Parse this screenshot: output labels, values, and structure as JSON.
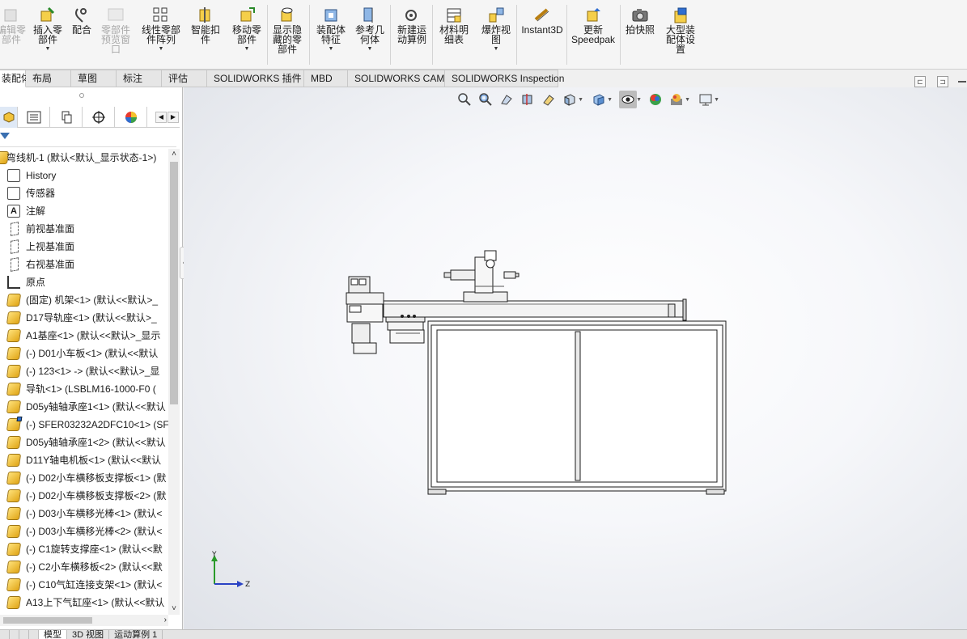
{
  "ribbon": {
    "buttons": [
      {
        "id": "edit-component",
        "label": "编辑零\n部件",
        "disabled": true
      },
      {
        "id": "insert-component",
        "label": "插入零\n部件",
        "dropdown": true
      },
      {
        "id": "mate",
        "label": "配合"
      },
      {
        "id": "component-preview",
        "label": "零部件\n预览窗\n口",
        "disabled": true
      },
      {
        "id": "linear-pattern",
        "label": "线性零部\n件阵列",
        "dropdown": true
      },
      {
        "id": "smart-fasteners",
        "label": "智能扣\n件"
      },
      {
        "id": "move-component",
        "label": "移动零\n部件",
        "dropdown": true
      },
      {
        "id": "show-hidden",
        "label": "显示隐\n藏的零\n部件"
      },
      {
        "id": "assembly-features",
        "label": "装配体\n特征",
        "dropdown": true
      },
      {
        "id": "reference-geometry",
        "label": "参考几\n何体",
        "dropdown": true
      },
      {
        "id": "new-motion-study",
        "label": "新建运\n动算例"
      },
      {
        "id": "bom",
        "label": "材料明\n细表"
      },
      {
        "id": "exploded-view",
        "label": "爆炸视\n图",
        "dropdown": true
      },
      {
        "id": "instant3d",
        "label": "Instant3D"
      },
      {
        "id": "update-speedpak",
        "label": "更新\nSpeedpak"
      },
      {
        "id": "take-snapshot",
        "label": "拍快照"
      },
      {
        "id": "large-assembly",
        "label": "大型装\n配体设\n置"
      }
    ]
  },
  "command_tabs": [
    "装配体",
    "布局",
    "草图",
    "标注",
    "评估",
    "SOLIDWORKS 插件",
    "MBD",
    "SOLIDWORKS CAM",
    "SOLIDWORKS Inspection"
  ],
  "tree": {
    "root": "弯线机-1  (默认<默认_显示状态-1>)",
    "items": [
      {
        "type": "history",
        "label": "History"
      },
      {
        "type": "sensor",
        "label": "传感器"
      },
      {
        "type": "annotation",
        "label": "注解"
      },
      {
        "type": "plane",
        "label": "前视基准面"
      },
      {
        "type": "plane",
        "label": "上视基准面"
      },
      {
        "type": "plane",
        "label": "右视基准面"
      },
      {
        "type": "origin",
        "label": "原点"
      },
      {
        "type": "part",
        "label": "(固定) 机架<1> (默认<<默认>_"
      },
      {
        "type": "part",
        "label": "D17导轨座<1> (默认<<默认>_"
      },
      {
        "type": "part",
        "label": "A1基座<1> (默认<<默认>_显示"
      },
      {
        "type": "part",
        "label": "(-) D01小车板<1> (默认<<默认"
      },
      {
        "type": "part",
        "label": "(-) 123<1> -> (默认<<默认>_显"
      },
      {
        "type": "part",
        "label": "导轨<1> (LSBLM16-1000-F0 ("
      },
      {
        "type": "part",
        "label": "D05y轴轴承座1<1> (默认<<默认"
      },
      {
        "type": "part-special",
        "label": "(-) SFER03232A2DFC10<1> (SF"
      },
      {
        "type": "part",
        "label": "D05y轴轴承座1<2> (默认<<默认"
      },
      {
        "type": "part",
        "label": "D11Y轴电机板<1> (默认<<默认"
      },
      {
        "type": "part",
        "label": "(-) D02小车横移板支撑板<1> (默"
      },
      {
        "type": "part",
        "label": "(-) D02小车横移板支撑板<2> (默"
      },
      {
        "type": "part",
        "label": "(-) D03小车横移光棒<1> (默认<"
      },
      {
        "type": "part",
        "label": "(-) D03小车横移光棒<2> (默认<"
      },
      {
        "type": "part",
        "label": "(-) C1旋转支撑座<1> (默认<<默"
      },
      {
        "type": "part",
        "label": "(-) C2小车横移板<2> (默认<<默"
      },
      {
        "type": "part",
        "label": "(-) C10气缸连接支架<1> (默认<"
      },
      {
        "type": "part",
        "label": "A13上下气缸座<1> (默认<<默认"
      }
    ]
  },
  "triad": {
    "y_label": "Y",
    "z_label": "Z"
  },
  "bottom_tabs": [
    "模型",
    "3D 视图",
    "运动算例 1"
  ]
}
